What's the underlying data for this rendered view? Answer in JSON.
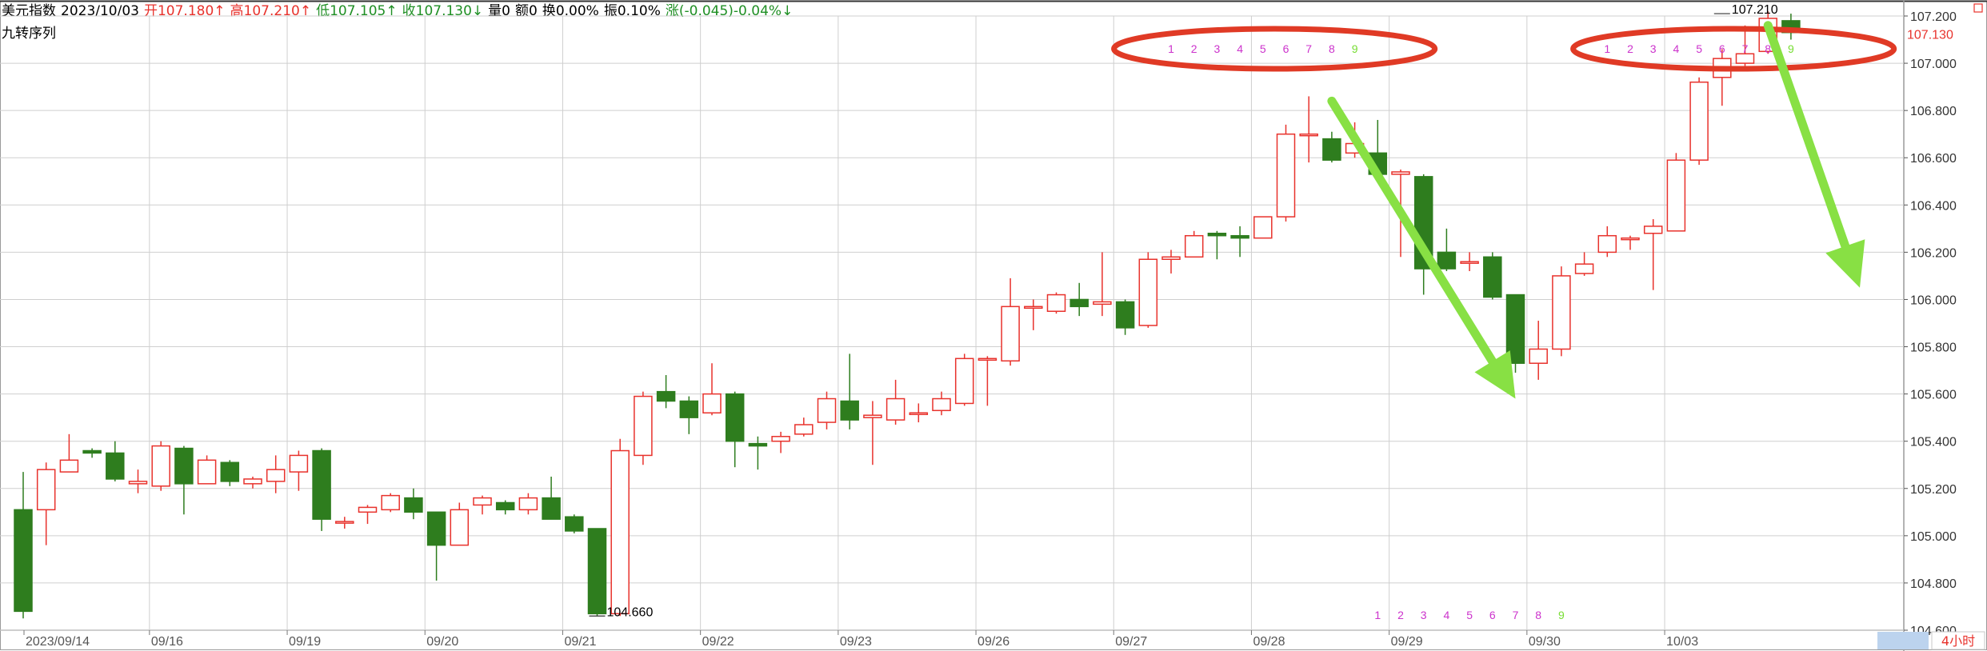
{
  "header": {
    "name": "美元指数",
    "date": "2023/10/03",
    "open": "开107.180↑",
    "high": "高107.210↑",
    "low": "低107.105↑",
    "close": "收107.130↓",
    "volume": "量0",
    "amount": "额0",
    "turnover": "换0.00%",
    "amplitude": "振0.10%",
    "change": "涨(-0.045)-0.04%↓"
  },
  "indicator_label": "九转序列",
  "period_tab": "4小时",
  "colors": {
    "up": "#e8322c",
    "down": "#2e7d1e",
    "grid": "#cfcfcf",
    "seq_magenta": "#cc33cc",
    "seq_green": "#77dd33",
    "ellipse": "#e03a25",
    "arrow": "#88e044"
  },
  "chart_data": {
    "type": "candlestick",
    "title": "",
    "ylim": [
      104.6,
      107.2
    ],
    "y_ticks": [
      "107.200",
      "107.000",
      "106.800",
      "106.600",
      "106.400",
      "106.200",
      "106.000",
      "105.800",
      "105.600",
      "105.400",
      "105.200",
      "105.000",
      "104.800",
      "104.600"
    ],
    "x_labels": [
      "2023/09/14",
      "09/16",
      "09/19",
      "09/20",
      "09/21",
      "09/22",
      "09/23",
      "09/26",
      "09/27",
      "09/28",
      "09/29",
      "09/30",
      "10/03"
    ],
    "x_label_index": [
      0,
      6,
      12,
      18,
      24,
      30,
      36,
      42,
      48,
      54,
      60,
      66,
      72
    ],
    "last_price_label": "107.130",
    "annotations": [
      {
        "text": "107.210",
        "index": 74,
        "value": 107.21
      },
      {
        "text": "104.660",
        "index": 25,
        "value": 104.66
      }
    ],
    "candles": [
      [
        105.11,
        104.68,
        105.27,
        104.65
      ],
      [
        105.11,
        105.28,
        105.31,
        104.96
      ],
      [
        105.27,
        105.32,
        105.43,
        105.27
      ],
      [
        105.36,
        105.35,
        105.37,
        105.33
      ],
      [
        105.35,
        105.24,
        105.4,
        105.23
      ],
      [
        105.22,
        105.23,
        105.28,
        105.18
      ],
      [
        105.21,
        105.38,
        105.4,
        105.19
      ],
      [
        105.37,
        105.22,
        105.38,
        105.09
      ],
      [
        105.22,
        105.32,
        105.34,
        105.22
      ],
      [
        105.31,
        105.23,
        105.32,
        105.21
      ],
      [
        105.22,
        105.24,
        105.25,
        105.2
      ],
      [
        105.23,
        105.28,
        105.34,
        105.18
      ],
      [
        105.27,
        105.34,
        105.36,
        105.19
      ],
      [
        105.36,
        105.07,
        105.37,
        105.02
      ],
      [
        105.06,
        105.06,
        105.08,
        105.03
      ],
      [
        105.1,
        105.12,
        105.13,
        105.05
      ],
      [
        105.11,
        105.17,
        105.18,
        105.1
      ],
      [
        105.16,
        105.1,
        105.2,
        105.07
      ],
      [
        105.1,
        104.96,
        105.1,
        104.81
      ],
      [
        104.96,
        105.11,
        105.14,
        104.96
      ],
      [
        105.13,
        105.16,
        105.17,
        105.09
      ],
      [
        105.14,
        105.11,
        105.15,
        105.09
      ],
      [
        105.11,
        105.16,
        105.18,
        105.09
      ],
      [
        105.16,
        105.07,
        105.25,
        105.07
      ],
      [
        105.08,
        105.02,
        105.09,
        105.01
      ],
      [
        105.03,
        104.67,
        105.03,
        104.66
      ],
      [
        104.67,
        105.36,
        105.41,
        104.66
      ],
      [
        105.34,
        105.59,
        105.61,
        105.3
      ],
      [
        105.61,
        105.57,
        105.68,
        105.54
      ],
      [
        105.57,
        105.5,
        105.59,
        105.43
      ],
      [
        105.52,
        105.6,
        105.73,
        105.51
      ],
      [
        105.6,
        105.4,
        105.61,
        105.29
      ],
      [
        105.39,
        105.38,
        105.42,
        105.28
      ],
      [
        105.4,
        105.42,
        105.44,
        105.35
      ],
      [
        105.43,
        105.47,
        105.5,
        105.42
      ],
      [
        105.48,
        105.58,
        105.61,
        105.45
      ],
      [
        105.57,
        105.49,
        105.77,
        105.45
      ],
      [
        105.5,
        105.51,
        105.57,
        105.3
      ],
      [
        105.49,
        105.58,
        105.66,
        105.47
      ],
      [
        105.52,
        105.52,
        105.56,
        105.48
      ],
      [
        105.53,
        105.58,
        105.61,
        105.51
      ],
      [
        105.56,
        105.75,
        105.77,
        105.55
      ],
      [
        105.75,
        105.75,
        105.76,
        105.55
      ],
      [
        105.74,
        105.97,
        106.09,
        105.72
      ],
      [
        105.97,
        105.97,
        106.0,
        105.87
      ],
      [
        105.95,
        106.02,
        106.03,
        105.94
      ],
      [
        106.0,
        105.97,
        106.07,
        105.93
      ],
      [
        105.98,
        105.99,
        106.2,
        105.93
      ],
      [
        105.99,
        105.88,
        106.0,
        105.85
      ],
      [
        105.89,
        106.17,
        106.2,
        105.88
      ],
      [
        106.17,
        106.18,
        106.21,
        106.11
      ],
      [
        106.18,
        106.27,
        106.29,
        106.18
      ],
      [
        106.28,
        106.27,
        106.29,
        106.17
      ],
      [
        106.27,
        106.26,
        106.31,
        106.18
      ],
      [
        106.26,
        106.35,
        106.35,
        106.26
      ],
      [
        106.35,
        106.7,
        106.74,
        106.33
      ],
      [
        106.7,
        106.7,
        106.86,
        106.58
      ],
      [
        106.68,
        106.59,
        106.71,
        106.58
      ],
      [
        106.62,
        106.66,
        106.75,
        106.6
      ],
      [
        106.62,
        106.53,
        106.76,
        106.51
      ],
      [
        106.53,
        106.54,
        106.55,
        106.18
      ],
      [
        106.52,
        106.13,
        106.53,
        106.02
      ],
      [
        106.2,
        106.13,
        106.3,
        106.12
      ],
      [
        106.16,
        106.16,
        106.2,
        106.12
      ],
      [
        106.18,
        106.01,
        106.2,
        106.0
      ],
      [
        106.02,
        105.73,
        106.02,
        105.69
      ],
      [
        105.73,
        105.79,
        105.91,
        105.66
      ],
      [
        105.79,
        106.1,
        106.14,
        105.76
      ],
      [
        106.11,
        106.15,
        106.2,
        106.1
      ],
      [
        106.2,
        106.27,
        106.31,
        106.18
      ],
      [
        106.26,
        106.26,
        106.27,
        106.21
      ],
      [
        106.28,
        106.31,
        106.34,
        106.04
      ],
      [
        106.29,
        106.59,
        106.62,
        106.29
      ],
      [
        106.59,
        106.92,
        106.94,
        106.57
      ],
      [
        106.94,
        107.02,
        107.06,
        106.82
      ],
      [
        107.0,
        107.04,
        107.16,
        106.98
      ],
      [
        107.05,
        107.19,
        107.22,
        107.04
      ],
      [
        107.18,
        107.13,
        107.21,
        107.1
      ]
    ],
    "td_sequence": [
      {
        "labels": [
          "1",
          "2",
          "3",
          "4",
          "5",
          "6",
          "7",
          "8",
          "9"
        ],
        "start_index": 50,
        "position": "top"
      },
      {
        "labels": [
          "1",
          "2",
          "3",
          "4",
          "5",
          "6",
          "7",
          "8",
          "9"
        ],
        "start_index": 69,
        "position": "top"
      },
      {
        "labels": [
          "1",
          "2",
          "3",
          "4",
          "5",
          "6",
          "7",
          "8",
          "9"
        ],
        "start_index": 59,
        "position": "bottom"
      }
    ],
    "highlight_ellipses": [
      {
        "from_index": 48,
        "to_index": 61
      },
      {
        "from_index": 68,
        "to_index": 81
      }
    ],
    "arrows": [
      {
        "from": [
          57,
          106.84
        ],
        "to": [
          65,
          105.58
        ]
      },
      {
        "from": [
          76,
          107.16
        ],
        "to": [
          80,
          106.05
        ]
      }
    ]
  }
}
